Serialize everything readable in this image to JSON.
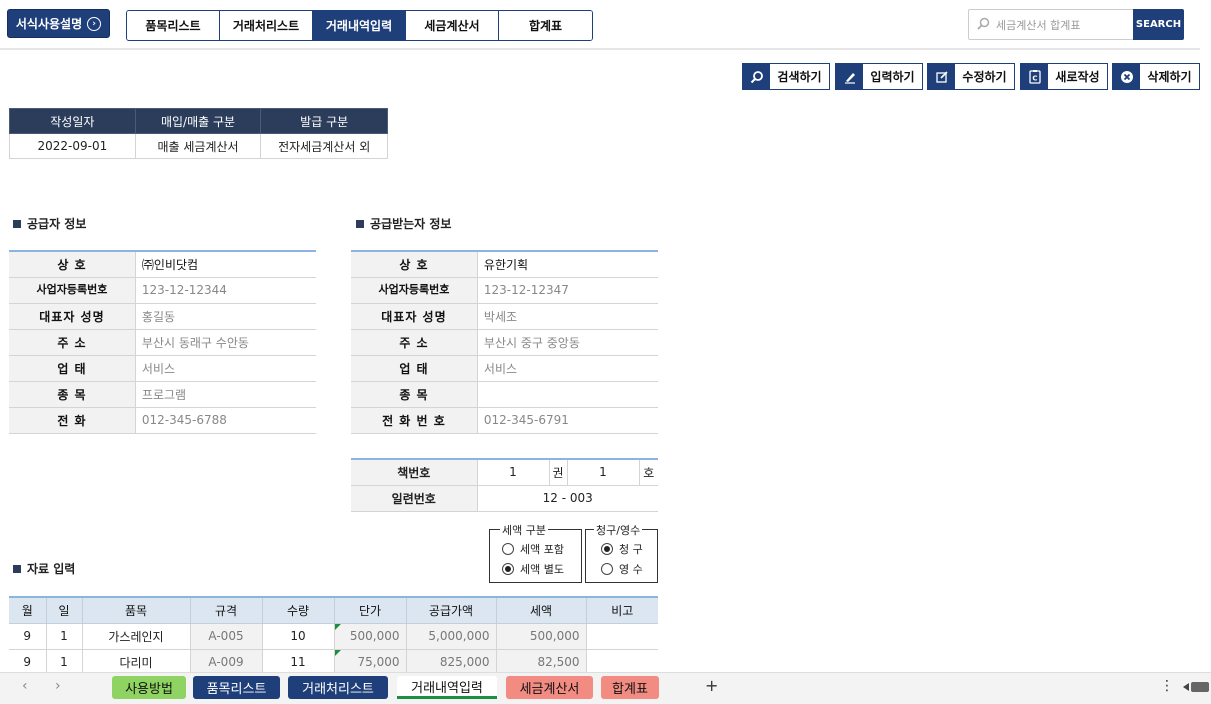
{
  "header": {
    "help_label": "서식사용설명",
    "nav_tabs": [
      "품목리스트",
      "거래처리스트",
      "거래내역입력",
      "세금계산서",
      "합계표"
    ],
    "active_tab": 2,
    "search_placeholder": "세금계산서 합계표",
    "search_label": "SEARCH"
  },
  "actions": {
    "search": "검색하기",
    "input": "입력하기",
    "edit": "수정하기",
    "new": "새로작성",
    "delete": "삭제하기"
  },
  "meta": {
    "headers": [
      "작성일자",
      "매입/매출 구분",
      "발급 구분"
    ],
    "values": [
      "2022-09-01",
      "매출 세금계산서",
      "전자세금계산서 외"
    ]
  },
  "supplier": {
    "title": "공급자 정보",
    "rows": [
      {
        "k": "상           호",
        "v": "㈜인비닷컴"
      },
      {
        "k": "사업자등록번호",
        "v": "123-12-12344"
      },
      {
        "k": "대표자 성명",
        "v": "홍길동"
      },
      {
        "k": "주           소",
        "v": "부산시 동래구 수안동"
      },
      {
        "k": "업           태",
        "v": "서비스"
      },
      {
        "k": "종           목",
        "v": "프로그램"
      },
      {
        "k": "전           화",
        "v": "012-345-6788"
      }
    ]
  },
  "receiver": {
    "title": "공급받는자 정보",
    "rows": [
      {
        "k": "상           호",
        "v": "유한기획"
      },
      {
        "k": "사업자등록번호",
        "v": "123-12-12347"
      },
      {
        "k": "대표자 성명",
        "v": "박세조"
      },
      {
        "k": "주           소",
        "v": "부산시 중구 중앙동"
      },
      {
        "k": "업           태",
        "v": "서비스"
      },
      {
        "k": "종           목",
        "v": ""
      },
      {
        "k": "전 화 번 호",
        "v": "012-345-6791"
      }
    ]
  },
  "book": {
    "book_label": "책번호",
    "book_vol": "1",
    "vol_unit": "권",
    "book_no": "1",
    "no_unit": "호",
    "serial_label": "일련번호",
    "serial": "12 - 003"
  },
  "tax_type": {
    "legend": "세액 구분",
    "options": [
      "세액 포함",
      "세액 별도"
    ],
    "selected": 1
  },
  "claim_type": {
    "legend": "청구/영수",
    "options": [
      "청 구",
      "영 수"
    ],
    "selected": 0
  },
  "items": {
    "title": "자료 입력",
    "headers": [
      "월",
      "일",
      "품목",
      "규격",
      "수량",
      "단가",
      "공급가액",
      "세액",
      "비고"
    ],
    "rows": [
      [
        "9",
        "1",
        "가스레인지",
        "A-005",
        "10",
        "500,000",
        "5,000,000",
        "500,000",
        ""
      ],
      [
        "9",
        "1",
        "다리미",
        "A-009",
        "11",
        "75,000",
        "825,000",
        "82,500",
        ""
      ]
    ]
  },
  "sheets": [
    "사용방법",
    "품목리스트",
    "거래처리스트",
    "거래내역입력",
    "세금계산서",
    "합계표"
  ],
  "colors": {
    "navy": "#1f3f7a",
    "green": "#8fd462",
    "blue": "#1f3f7a",
    "red": "#f28b82"
  }
}
